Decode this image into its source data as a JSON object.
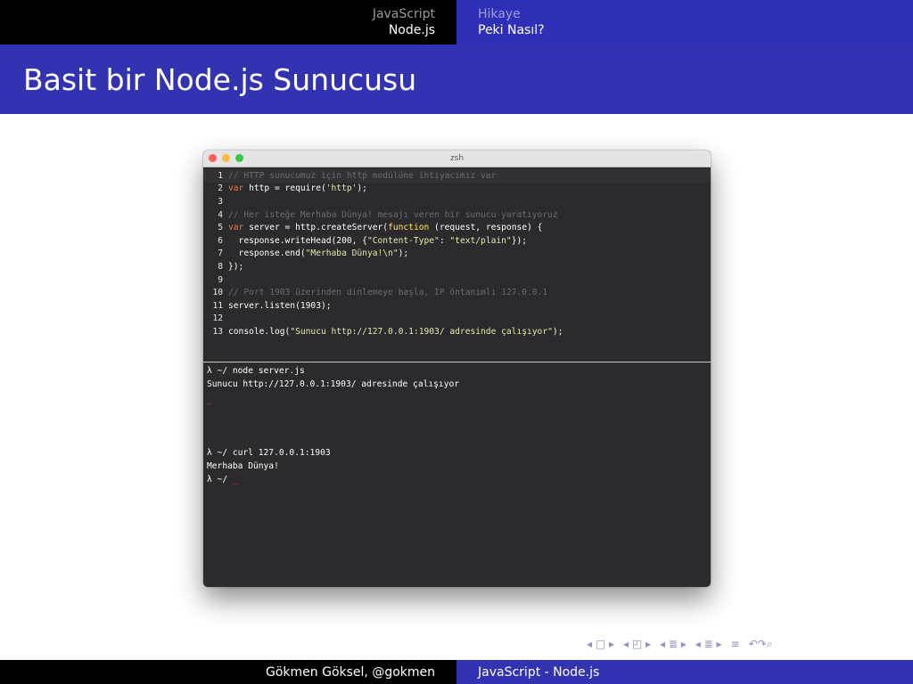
{
  "nav": {
    "left_section": "JavaScript",
    "left_subsection": "Node.js",
    "right_section": "Hikaye",
    "right_subsection": "Peki Nasıl?"
  },
  "frame": {
    "title": "Basit bir Node.js Sunucusu"
  },
  "window": {
    "title": "zsh"
  },
  "editor": {
    "lines": [
      {
        "num": "1",
        "parts": [
          {
            "t": "// HTTP sunucumuz için http modülüne ihtiyacımız var",
            "c": "cm"
          }
        ]
      },
      {
        "num": "2",
        "parts": [
          {
            "t": "var",
            "c": "kw"
          },
          {
            "t": " http = require(",
            "c": "plain"
          },
          {
            "t": "'http'",
            "c": "st"
          },
          {
            "t": ");",
            "c": "plain"
          }
        ]
      },
      {
        "num": "3",
        "parts": []
      },
      {
        "num": "4",
        "parts": [
          {
            "t": "// Her isteğe Merhaba Dünya! mesajı veren bir sunucu yaratıyoruz",
            "c": "cm"
          }
        ]
      },
      {
        "num": "5",
        "parts": [
          {
            "t": "var",
            "c": "kw"
          },
          {
            "t": " server = http.createServer(",
            "c": "plain"
          },
          {
            "t": "function",
            "c": "fn"
          },
          {
            "t": " (request, response) {",
            "c": "plain"
          }
        ]
      },
      {
        "num": "6",
        "parts": [
          {
            "t": "  response.writeHead(200, {",
            "c": "plain"
          },
          {
            "t": "\"Content-Type\"",
            "c": "st"
          },
          {
            "t": ": ",
            "c": "plain"
          },
          {
            "t": "\"text/plain\"",
            "c": "st"
          },
          {
            "t": "});",
            "c": "plain"
          }
        ]
      },
      {
        "num": "7",
        "parts": [
          {
            "t": "  response.end(",
            "c": "plain"
          },
          {
            "t": "\"Merhaba Dünya!\\n\"",
            "c": "st"
          },
          {
            "t": ");",
            "c": "plain"
          }
        ]
      },
      {
        "num": "8",
        "parts": [
          {
            "t": "});",
            "c": "plain"
          }
        ]
      },
      {
        "num": "9",
        "parts": []
      },
      {
        "num": "10",
        "parts": [
          {
            "t": "// Port 1903 üzerinden dinlemeye başla, IP öntanımlı 127.0.0.1",
            "c": "cm"
          }
        ]
      },
      {
        "num": "11",
        "parts": [
          {
            "t": "server.listen(1903);",
            "c": "plain"
          }
        ]
      },
      {
        "num": "12",
        "parts": []
      },
      {
        "num": "13",
        "parts": [
          {
            "t": "console.log(",
            "c": "plain"
          },
          {
            "t": "\"Sunucu http://127.0.0.1:1903/ adresinde çalışıyor\"",
            "c": "st"
          },
          {
            "t": ");",
            "c": "plain"
          }
        ]
      }
    ]
  },
  "terminal": {
    "line1": "λ ~/ node server.js",
    "line2": "Sunucu http://127.0.0.1:1903/ adresinde çalışıyor",
    "cursor": "_",
    "line4": "λ ~/ curl 127.0.0.1:1903",
    "line5": "Merhaba Dünya!",
    "line6": "λ ~/ "
  },
  "footer": {
    "author": "Gökmen Göksel, @gokmen",
    "title": "JavaScript - Node.js"
  }
}
